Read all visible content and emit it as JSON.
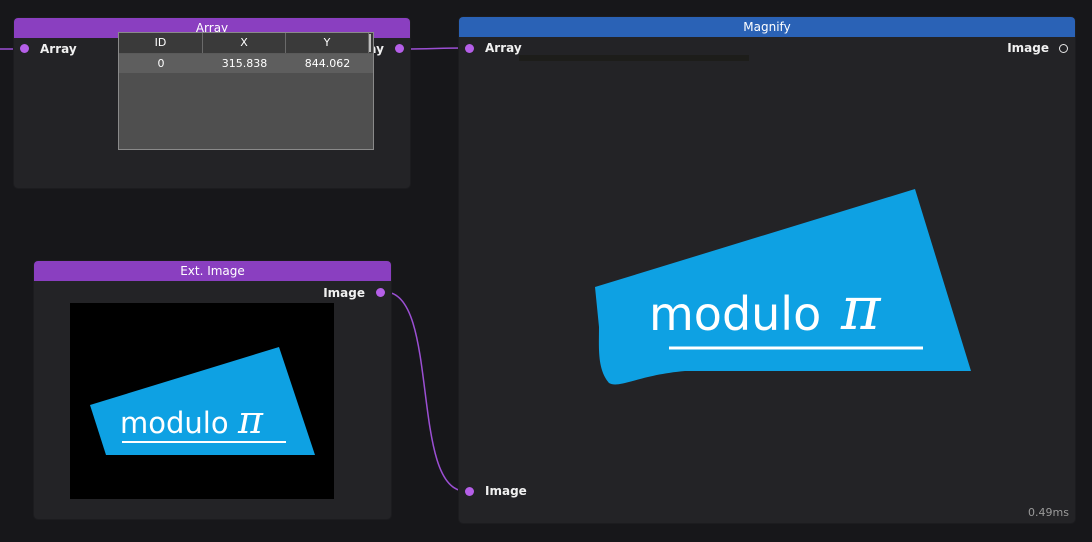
{
  "colors": {
    "background": "#17171a",
    "node_body": "#232326",
    "header_purple": "#8a3fc0",
    "header_blue": "#2a62b6",
    "port_purple": "#b55fe8",
    "logo_blue": "#0ea1e3"
  },
  "array_node": {
    "title": "Array",
    "input_port": "Array",
    "output_port": "Array",
    "table": {
      "columns": [
        "ID",
        "X",
        "Y"
      ],
      "rows": [
        [
          "0",
          "315.838",
          "844.062"
        ]
      ]
    }
  },
  "ext_image_node": {
    "title": "Ext. Image",
    "output_port": "Image",
    "logo_text": "modulo",
    "logo_symbol": "π"
  },
  "magnify_node": {
    "title": "Magnify",
    "input_array_port": "Array",
    "input_image_port": "Image",
    "output_port": "Image",
    "logo_text": "modulo",
    "logo_symbol": "π",
    "timing": "0.49ms"
  }
}
